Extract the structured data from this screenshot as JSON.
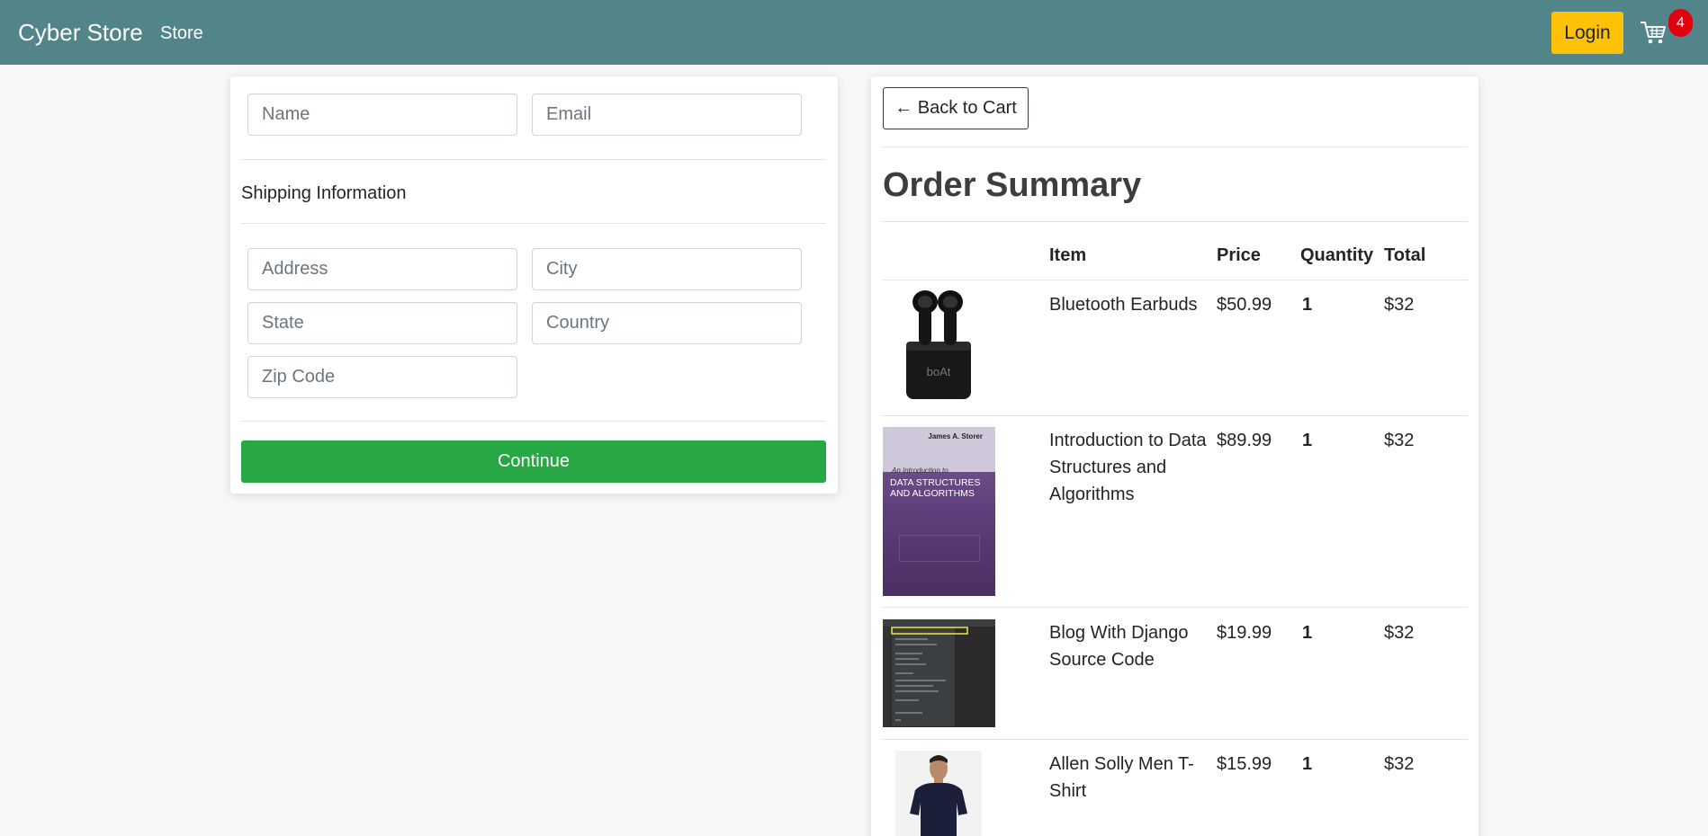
{
  "navbar": {
    "brand": "Cyber Store",
    "store_link": "Store",
    "login_label": "Login",
    "cart_icon": "shopping-cart-icon",
    "cart_count": "4"
  },
  "form": {
    "name_placeholder": "Name",
    "email_placeholder": "Email",
    "shipping_title": "Shipping Information",
    "address_placeholder": "Address",
    "city_placeholder": "City",
    "state_placeholder": "State",
    "country_placeholder": "Country",
    "zip_placeholder": "Zip Code",
    "continue_label": "Continue"
  },
  "summary": {
    "back_label": "← Back to Cart",
    "title": "Order Summary",
    "headers": {
      "item": "Item",
      "price": "Price",
      "quantity": "Quantity",
      "total": "Total"
    },
    "items": [
      {
        "name": "Bluetooth Earbuds",
        "price": "$50.99",
        "quantity": "1",
        "total": "$32",
        "image": "earbuds-image"
      },
      {
        "name": "Introduction to Data Structures and Algorithms",
        "price": "$89.99",
        "quantity": "1",
        "total": "$32",
        "image": "book-cover-image",
        "book_author": "James A. Storer",
        "book_subtitle": "An Introduction to",
        "book_title": "DATA STRUCTURES AND ALGORITHMS"
      },
      {
        "name": "Blog With Django Source Code",
        "price": "$19.99",
        "quantity": "1",
        "total": "$32",
        "image": "code-editor-screenshot-image"
      },
      {
        "name": "Allen Solly Men T-Shirt",
        "price": "$15.99",
        "quantity": "1",
        "total": "$32",
        "image": "tshirt-model-image"
      }
    ]
  },
  "colors": {
    "navbar": "#528589",
    "login": "#ffc107",
    "continue": "#28a745",
    "badge": "#e0000f"
  }
}
